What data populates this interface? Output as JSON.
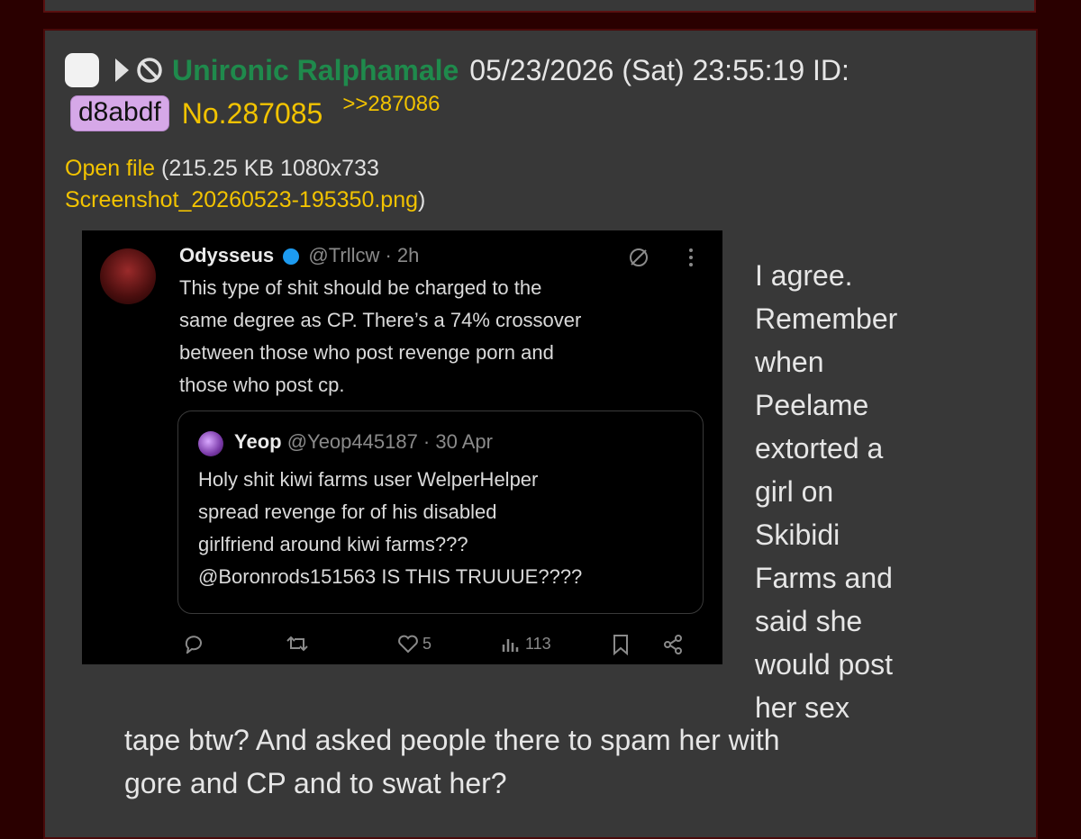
{
  "post": {
    "name": "Unironic Ralphamale",
    "datetime": "05/23/2026 (Sat) 23:55:19 ID:",
    "id": "d8abdf",
    "post_no": "No.287085",
    "backlink": ">>287086",
    "file": {
      "open_label": "Open file",
      "info_prefix": "(215.25 KB 1080x733",
      "filename": "Screenshot_20260523-195350.png",
      "info_suffix": ")"
    },
    "tweet": {
      "author": "Odysseus",
      "handle": "@Trllcw · 2h",
      "lines": [
        "This type of shit should be charged to the",
        "same degree as CP. There’s a 74% crossover",
        "between those who post revenge porn and",
        "those who post cp."
      ],
      "quote": {
        "author": "Yeop",
        "handle": "@Yeop445187 · 30 Apr",
        "lines": [
          "Holy shit kiwi farms user WelperHelper",
          "spread revenge for of his disabled",
          "girlfriend around kiwi farms???",
          "@Boronrods151563 IS THIS TRUUUE????"
        ]
      },
      "likes": "5",
      "views": "113"
    },
    "message_lines_side": [
      "I agree.",
      "Remember",
      "when",
      "Peelame",
      "extorted a",
      "girl on",
      "Skibidi",
      "Farms and",
      "said she",
      "would post",
      "her sex"
    ],
    "message_lines_full": [
      "tape btw? And asked people there to spam her with",
      "gore and CP and to swat her?"
    ]
  },
  "colors": {
    "background": "#2a0000",
    "post_bg": "#383838",
    "name": "#1f8a4c",
    "link": "#f2c300",
    "id_badge": "#d6a8e8"
  }
}
